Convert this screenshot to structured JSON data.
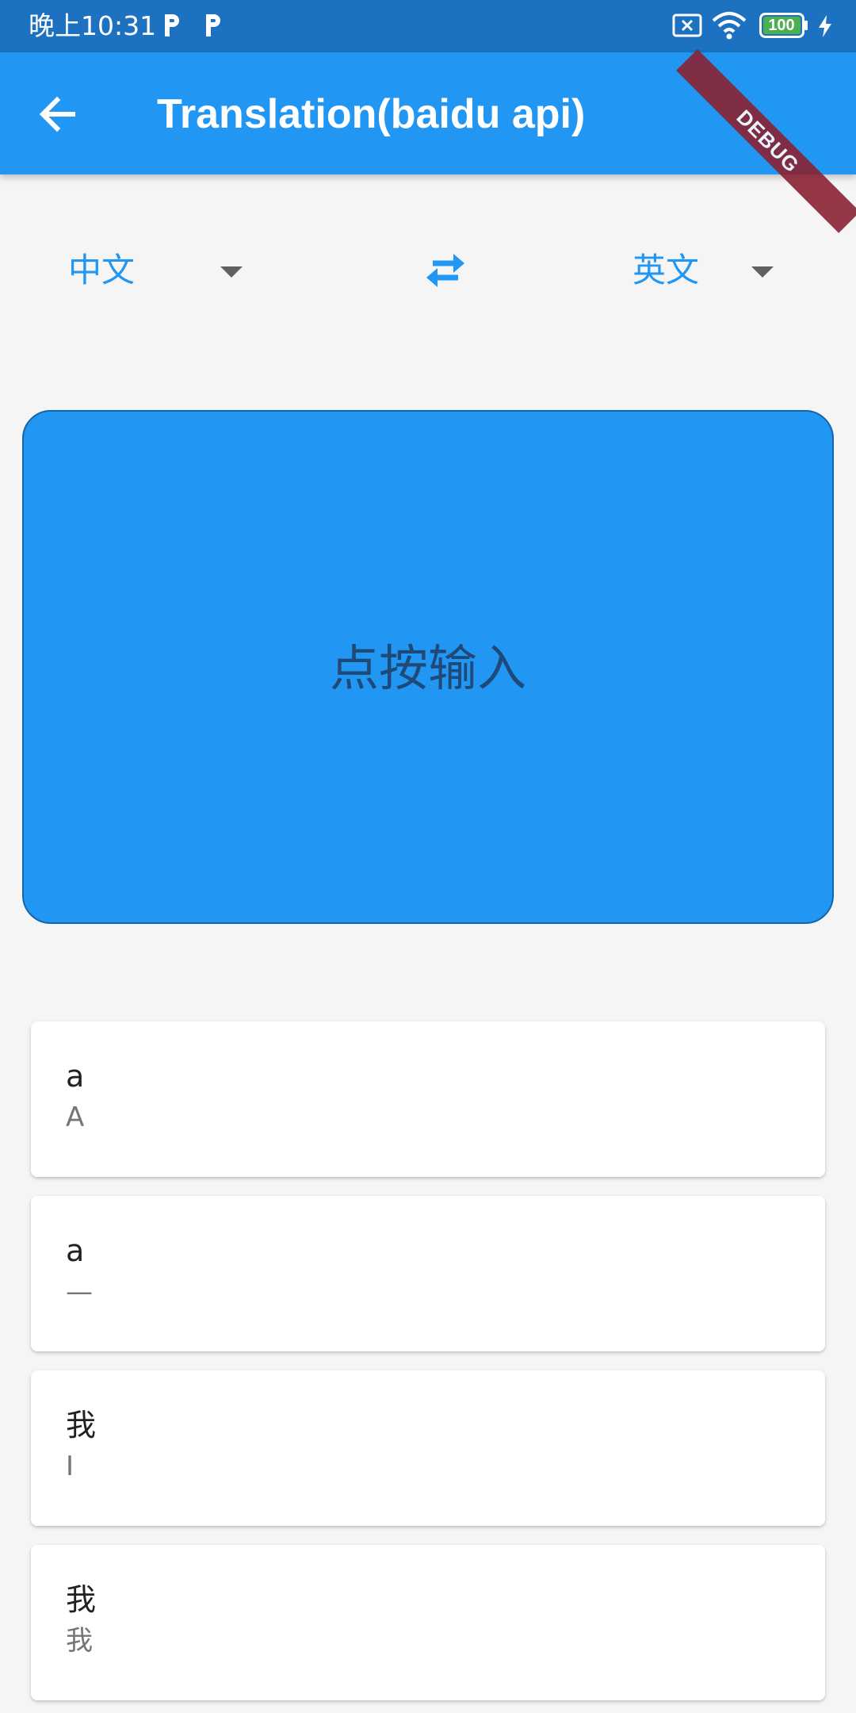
{
  "status_bar": {
    "time": "晚上10:31",
    "battery": "100",
    "notification_icons": [
      "p-icon",
      "p-icon"
    ],
    "right_icons": [
      "sim-x-icon",
      "wifi-icon",
      "battery-icon",
      "charging-bolt-icon"
    ]
  },
  "app_bar": {
    "title": "Translation(baidu api)",
    "back_icon": "arrow-back-icon",
    "debug_banner": "DEBUG"
  },
  "languages": {
    "source": "中文",
    "target": "英文",
    "swap_icon": "swap-horiz-icon"
  },
  "input": {
    "placeholder": "点按输入"
  },
  "history": [
    {
      "source": "a",
      "target": "A"
    },
    {
      "source": "a",
      "target": "—"
    },
    {
      "source": "我",
      "target": "I"
    },
    {
      "source": "我",
      "target": "我"
    }
  ],
  "colors": {
    "status_bar": "#1c72c0",
    "primary": "#2196f3",
    "background": "#f5f5f5",
    "debug_banner": "#8a2233"
  }
}
